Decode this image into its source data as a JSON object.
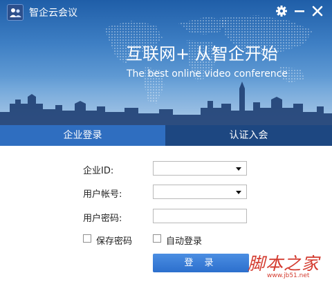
{
  "app": {
    "title": "智企云会议"
  },
  "titlebar": {
    "settings_icon": "gear-icon",
    "minimize_icon": "minimize-icon",
    "close_icon": "close-icon"
  },
  "banner": {
    "slogan": "互联网+ 从智企开始",
    "subslogan": "The best online video conference"
  },
  "tabs": [
    {
      "label": "企业登录",
      "active": true
    },
    {
      "label": "认证入会",
      "active": false
    }
  ],
  "form": {
    "enterprise_id_label": "企业ID:",
    "enterprise_id_value": "",
    "account_label": "用户帐号:",
    "account_value": "",
    "password_label": "用户密码:",
    "password_value": "",
    "save_password_label": "保存密码",
    "save_password_checked": false,
    "auto_login_label": "自动登录",
    "auto_login_checked": false,
    "login_label": "登 录"
  },
  "watermark": {
    "logo": "脚本之家",
    "url": "www.jb51.net"
  },
  "colors": {
    "tab_active": "#2f6ec0",
    "tab_inactive": "#1d4781",
    "button": "#3a7fd6",
    "watermark": "#d33b2f"
  }
}
